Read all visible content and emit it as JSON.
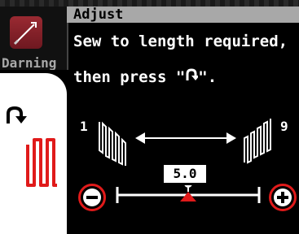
{
  "tab": {
    "label": "Darning"
  },
  "header": {
    "title": "Adjust"
  },
  "instructions": {
    "line1": "Sew to length required,",
    "line2": "then press \"",
    "line2_end": "\"."
  },
  "scale": {
    "min_label": "1",
    "max_label": "9",
    "value": "5.0",
    "min": 1,
    "max": 9,
    "current": 5.0
  },
  "icons": {
    "reverse_stitch": "reverse-stitch-icon",
    "darning_pattern": "darning-pattern-icon",
    "minus": "minus-icon",
    "plus": "plus-icon"
  },
  "colors": {
    "accent": "#e01a1a",
    "tab_icon": "#8a2230",
    "title_bar": "#a8a8a8"
  }
}
